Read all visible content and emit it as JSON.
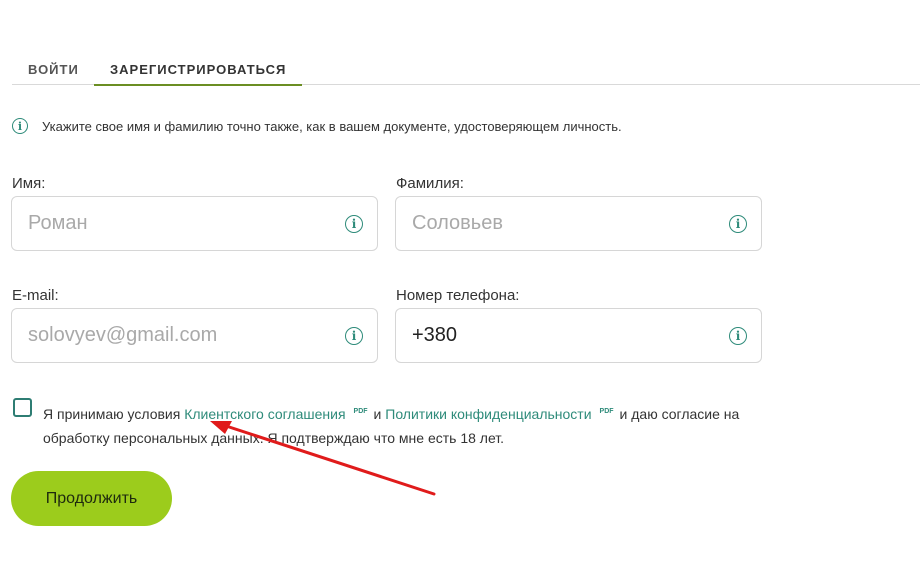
{
  "tabs": {
    "login": "ВОЙТИ",
    "register": "ЗАРЕГИСТРИРОВАТЬСЯ"
  },
  "info_text": "Укажите свое имя и фамилию точно также, как в вашем документе, удостоверяющем личность.",
  "fields": {
    "first_name": {
      "label": "Имя:",
      "placeholder": "Роман",
      "value": ""
    },
    "last_name": {
      "label": "Фамилия:",
      "placeholder": "Соловьев",
      "value": ""
    },
    "email": {
      "label": "E-mail:",
      "placeholder": "solovyev@gmail.com",
      "value": ""
    },
    "phone": {
      "label": "Номер телефона:",
      "placeholder": "",
      "value": "+380"
    }
  },
  "consent": {
    "checked": false,
    "prefix": "Я принимаю условия",
    "link1": "Клиентского соглашения",
    "pdf1": "PDF",
    "middle": "и",
    "link2": "Политики конфиденциальности",
    "pdf2": "PDF",
    "suffix": "и даю согласие на обработку персональных данных. Я подтверждаю что мне есть 18 лет."
  },
  "buttons": {
    "continue": "Продолжить"
  },
  "icons": {
    "info": "info-icon"
  },
  "colors": {
    "accent": "#2e8b7a",
    "button": "#9ccc1c",
    "annotation_arrow": "#e01b1b",
    "tab_underline": "#6b8e23"
  }
}
